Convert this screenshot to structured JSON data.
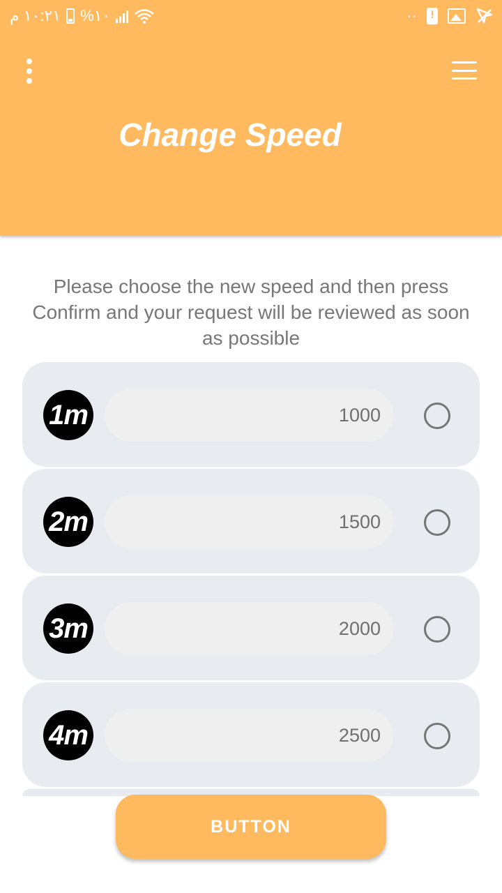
{
  "status_bar": {
    "time": "١٠:٢١ م",
    "battery_text": "%١٠"
  },
  "header": {
    "title": "Change Speed",
    "menu_icon": "more-vert-icon",
    "nav_icon": "hamburger-icon",
    "color": "#FFBA5F"
  },
  "description": "Please choose the new speed and then press Confirm and your request will be reviewed as soon as possible",
  "speed_options": [
    {
      "badge": "1m",
      "value": "1000",
      "selected": false
    },
    {
      "badge": "2m",
      "value": "1500",
      "selected": false
    },
    {
      "badge": "3m",
      "value": "2000",
      "selected": false
    },
    {
      "badge": "4m",
      "value": "2500",
      "selected": false
    }
  ],
  "action_button": {
    "label": "BUTTON"
  }
}
